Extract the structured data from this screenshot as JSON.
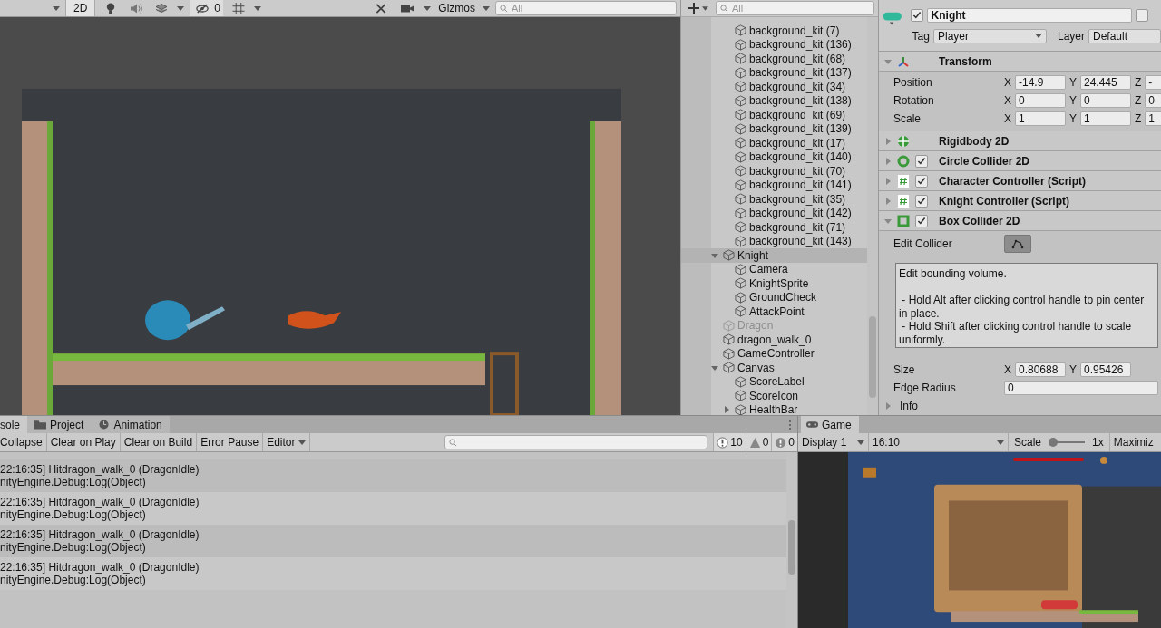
{
  "scene_toolbar": {
    "two_d": {
      "label": "2D",
      "selected": true
    },
    "hidden_count": "0",
    "gizmos": "Gizmos",
    "search": {
      "placeholder": "All"
    }
  },
  "hierarchy": {
    "search": {
      "placeholder": "All"
    },
    "partial_children": [
      {
        "name": "background_kit (7)",
        "selected": false,
        "disabled": false
      },
      {
        "name": "background_kit (136)",
        "selected": false,
        "disabled": false
      },
      {
        "name": "background_kit (68)",
        "selected": false,
        "disabled": false
      },
      {
        "name": "background_kit (137)",
        "selected": false,
        "disabled": false
      },
      {
        "name": "background_kit (34)",
        "selected": false,
        "disabled": false
      },
      {
        "name": "background_kit (138)",
        "selected": false,
        "disabled": false
      },
      {
        "name": "background_kit (69)",
        "selected": false,
        "disabled": false
      },
      {
        "name": "background_kit (139)",
        "selected": false,
        "disabled": false
      },
      {
        "name": "background_kit (17)",
        "selected": false,
        "disabled": false
      },
      {
        "name": "background_kit (140)",
        "selected": false,
        "disabled": false
      },
      {
        "name": "background_kit (70)",
        "selected": false,
        "disabled": false
      },
      {
        "name": "background_kit (141)",
        "selected": false,
        "disabled": false
      },
      {
        "name": "background_kit (35)",
        "selected": false,
        "disabled": false
      },
      {
        "name": "background_kit (142)",
        "selected": false,
        "disabled": false
      },
      {
        "name": "background_kit (71)",
        "selected": false,
        "disabled": false
      },
      {
        "name": "background_kit (143)",
        "selected": false,
        "disabled": false
      }
    ],
    "items": [
      {
        "name": "Knight",
        "selected": true,
        "disabled": false,
        "expanded": true,
        "children": [
          {
            "name": "Camera",
            "selected": false,
            "disabled": false
          },
          {
            "name": "KnightSprite",
            "selected": false,
            "disabled": false
          },
          {
            "name": "GroundCheck",
            "selected": false,
            "disabled": false
          },
          {
            "name": "AttackPoint",
            "selected": false,
            "disabled": false
          }
        ]
      },
      {
        "name": "Dragon",
        "selected": false,
        "disabled": true
      },
      {
        "name": "dragon_walk_0",
        "selected": false,
        "disabled": false
      },
      {
        "name": "GameController",
        "selected": false,
        "disabled": false
      },
      {
        "name": "Canvas",
        "selected": false,
        "disabled": false,
        "expanded": true,
        "children": [
          {
            "name": "ScoreLabel",
            "selected": false,
            "disabled": false
          },
          {
            "name": "ScoreIcon",
            "selected": false,
            "disabled": false
          },
          {
            "name": "HealthBar",
            "selected": false,
            "disabled": false,
            "expanded": false
          }
        ]
      }
    ]
  },
  "inspector": {
    "active": true,
    "name": "Knight",
    "static": false,
    "tag_label": "Tag",
    "tag": "Player",
    "layer_label": "Layer",
    "layer": "Default",
    "components": [
      {
        "kind": "transform",
        "title": "Transform",
        "expanded": true,
        "rows": [
          {
            "label": "Position",
            "fields": [
              {
                "axis": "X",
                "value": "-14.9"
              },
              {
                "axis": "Y",
                "value": "24.445"
              },
              {
                "axis": "Z",
                "value": "-"
              }
            ]
          },
          {
            "label": "Rotation",
            "fields": [
              {
                "axis": "X",
                "value": "0"
              },
              {
                "axis": "Y",
                "value": "0"
              },
              {
                "axis": "Z",
                "value": "0"
              }
            ]
          },
          {
            "label": "Scale",
            "fields": [
              {
                "axis": "X",
                "value": "1"
              },
              {
                "axis": "Y",
                "value": "1"
              },
              {
                "axis": "Z",
                "value": "1"
              }
            ]
          }
        ]
      },
      {
        "kind": "rigidbody",
        "title": "Rigidbody 2D",
        "expanded": false
      },
      {
        "kind": "circle",
        "title": "Circle Collider 2D",
        "enabled": true,
        "expanded": false
      },
      {
        "kind": "script",
        "title": "Character Controller (Script)",
        "enabled": true,
        "expanded": false
      },
      {
        "kind": "script",
        "title": "Knight Controller (Script)",
        "enabled": true,
        "expanded": false
      },
      {
        "kind": "box",
        "title": "Box Collider 2D",
        "enabled": true,
        "expanded": true,
        "props": [
          {
            "kind": "button",
            "label": "Edit Collider"
          },
          {
            "kind": "covered"
          },
          {
            "kind": "vector",
            "label": "Size",
            "fields": [
              {
                "axis": "X",
                "value": "0.80688"
              },
              {
                "axis": "Y",
                "value": "0.95426"
              }
            ]
          },
          {
            "kind": "number",
            "label": "Edge Radius",
            "value": "0"
          },
          {
            "kind": "foldout",
            "label": "Info",
            "expanded": false
          }
        ]
      }
    ],
    "tooltip": {
      "paragraphs": [
        "Edit bounding volume.",
        " - Hold Alt after clicking control handle to pin center in place.",
        " - Hold Shift after clicking control handle to scale uniformly."
      ]
    }
  },
  "console": {
    "tabs": [
      {
        "label": "sole",
        "kind": "console",
        "selected": true
      },
      {
        "label": "Project",
        "kind": "folder",
        "selected": false
      },
      {
        "label": "Animation",
        "kind": "clock",
        "selected": false
      }
    ],
    "buttons": [
      {
        "label": "Collapse"
      },
      {
        "label": "Clear on Play"
      },
      {
        "label": "Clear on Build"
      },
      {
        "label": "Error Pause"
      },
      {
        "label": "Editor",
        "kind": "dropdown"
      }
    ],
    "counts": [
      {
        "kind": "info",
        "count": "10"
      },
      {
        "kind": "warning",
        "count": "0"
      },
      {
        "kind": "error",
        "count": "0"
      }
    ],
    "entries": [
      {
        "message": "22:16:35] Hitdragon_walk_0 (DragonIdle)",
        "trace": "nityEngine.Debug:Log(Object)"
      },
      {
        "message": "22:16:35] Hitdragon_walk_0 (DragonIdle)",
        "trace": "nityEngine.Debug:Log(Object)"
      },
      {
        "message": "22:16:35] Hitdragon_walk_0 (DragonIdle)",
        "trace": "nityEngine.Debug:Log(Object)"
      },
      {
        "message": "22:16:35] Hitdragon_walk_0 (DragonIdle)",
        "trace": "nityEngine.Debug:Log(Object)"
      }
    ]
  },
  "game": {
    "tab": "Game",
    "display": "Display 1",
    "aspect": "16:10",
    "scale_label": "Scale",
    "scale": {
      "level": 0
    },
    "scale_value": "1x",
    "maximize": "Maximiz"
  }
}
